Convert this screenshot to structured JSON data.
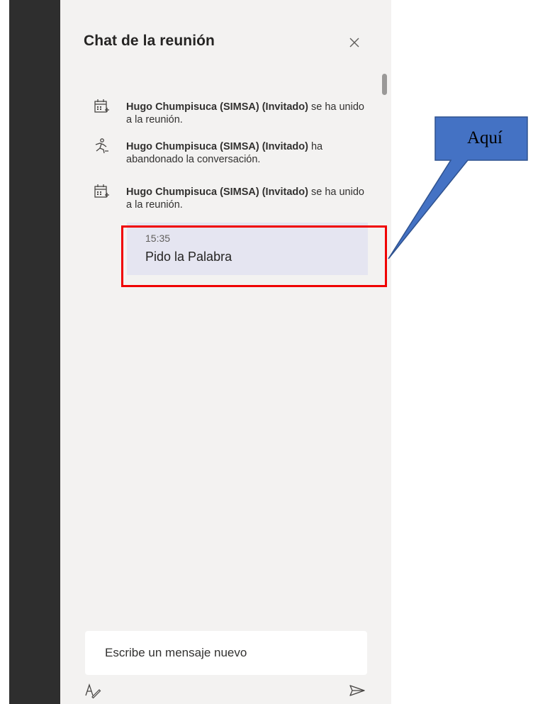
{
  "chat": {
    "title": "Chat de la reunión",
    "close_icon": "close-icon",
    "events": [
      {
        "icon": "calendar-join-icon",
        "name": "Hugo Chumpisuca (SIMSA) (Invitado)",
        "action": " se ha unido a la reunión."
      },
      {
        "icon": "person-leave-icon",
        "name": "Hugo Chumpisuca (SIMSA) (Invitado)",
        "action": " ha abandonado la conversación."
      },
      {
        "icon": "calendar-join-icon",
        "name": "Hugo Chumpisuca (SIMSA) (Invitado)",
        "action": " se ha unido a la reunión."
      }
    ],
    "message": {
      "time": "15:35",
      "text": "Pido la Palabra"
    },
    "compose": {
      "placeholder": "Escribe un mensaje nuevo",
      "format_icon": "format-text-icon",
      "send_icon": "send-icon"
    }
  },
  "annotation": {
    "callout_text": "Aquí",
    "callout_color": "#4472c4",
    "highlight_color": "#ff0000"
  },
  "colors": {
    "panel_bg": "#f3f2f1",
    "sidebar_bg": "#2e2e2e",
    "bubble_bg": "#e5e5f1"
  }
}
